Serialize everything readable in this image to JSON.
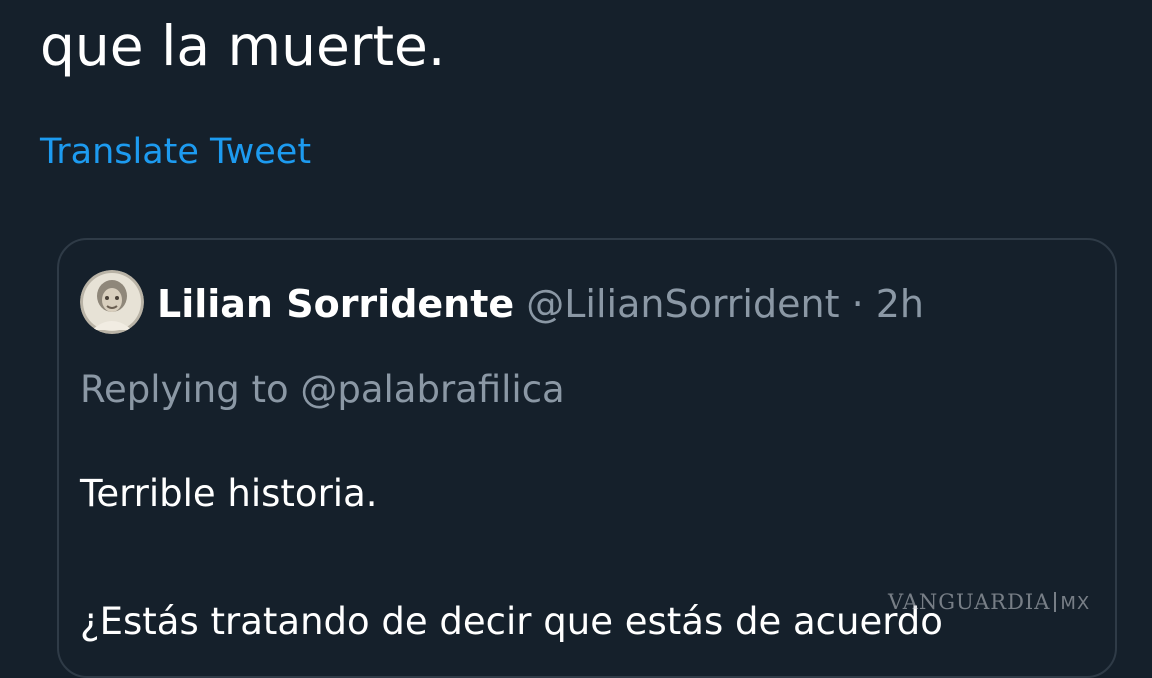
{
  "tweet": {
    "text_tail": "que la muerte.",
    "translate_label": "Translate Tweet"
  },
  "quoted_tweet": {
    "display_name": "Lilian Sorridente",
    "handle": "@LilianSorrident",
    "separator": "·",
    "time": "2h",
    "replying_prefix": "Replying to ",
    "replying_handle": "@palabrafilica",
    "text_line_1": "Terrible historia.",
    "text_line_2": "¿Estás tratando de decir que estás de acuerdo"
  },
  "watermark": {
    "brand": "VANGUARDIA",
    "suffix": "MX"
  },
  "colors": {
    "background": "#15202b",
    "link": "#1d9bf0",
    "secondary_text": "#8b98a5",
    "card_border": "#2f3b47"
  },
  "icons": {
    "avatar": "user-avatar"
  }
}
